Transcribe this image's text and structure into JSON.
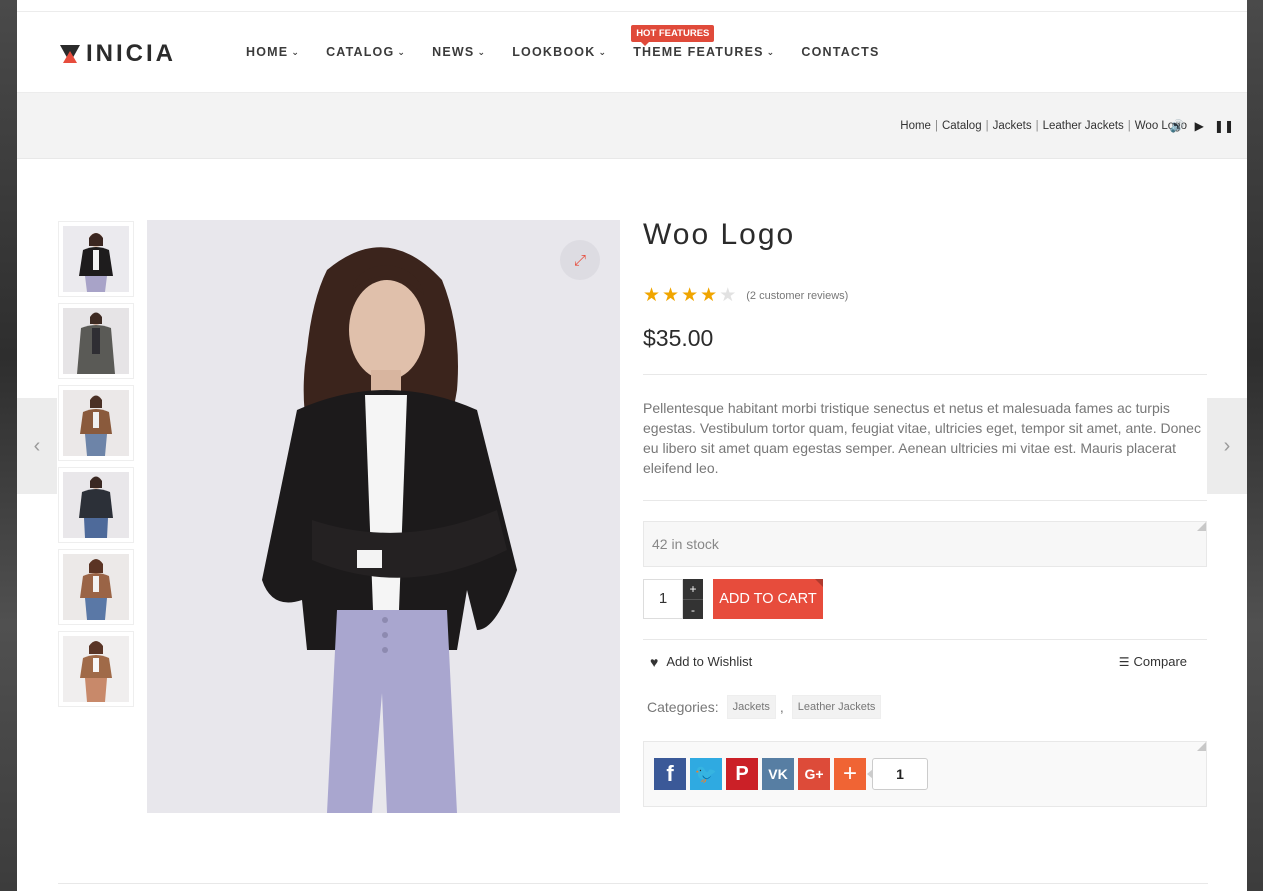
{
  "brand": {
    "logo_text": "INICIA"
  },
  "nav": {
    "items": [
      {
        "label": "HOME"
      },
      {
        "label": "CATALOG"
      },
      {
        "label": "NEWS"
      },
      {
        "label": "LOOKBOOK"
      },
      {
        "label": "THEME FEATURES",
        "badge": "HOT FEATURES"
      },
      {
        "label": "CONTACTS"
      }
    ]
  },
  "breadcrumb": [
    "Home",
    "Catalog",
    "Jackets",
    "Leather Jackets",
    "Woo Logo"
  ],
  "product": {
    "title": "Woo Logo",
    "rating": 4,
    "rating_max": 5,
    "reviews_text": "(2 customer reviews)",
    "price": "$35.00",
    "description": "Pellentesque habitant morbi tristique senectus et netus et malesuada fames ac turpis egestas. Vestibulum tortor quam, feugiat vitae, ultricies eget, tempor sit amet, ante. Donec eu libero sit amet quam egestas semper. Aenean ultricies mi vitae est. Mauris placerat eleifend leo.",
    "stock": "42 in stock",
    "quantity": "1",
    "add_to_cart": "ADD TO CART",
    "wishlist": "Add to Wishlist",
    "compare": "Compare",
    "categories_label": "Categories:",
    "categories": [
      "Jackets",
      "Leather Jackets"
    ],
    "share_count": "1"
  },
  "colors": {
    "accent": "#e74c3c",
    "star": "#f0a500",
    "facebook": "#3b5998",
    "twitter": "#2faae1",
    "pinterest": "#cb2027",
    "vk": "#577ea3",
    "googleplus": "#dd4b39",
    "more": "#f06434"
  }
}
